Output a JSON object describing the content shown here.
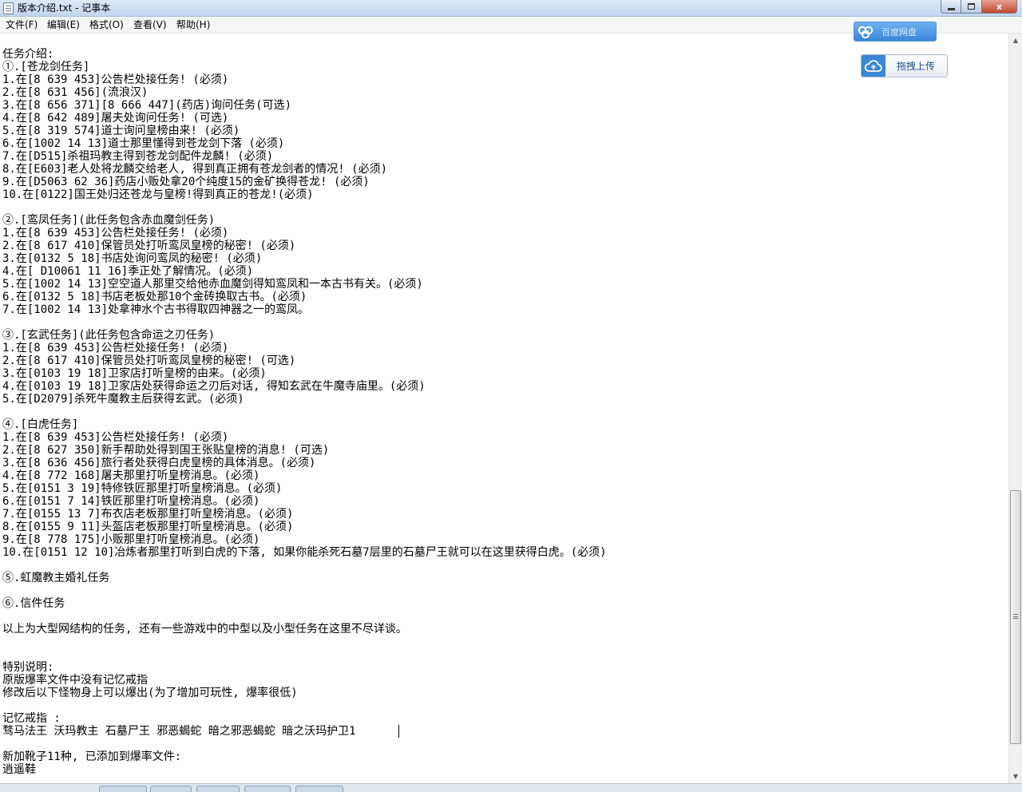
{
  "window": {
    "title": "版本介绍.txt - 记事本",
    "min_label": "",
    "max_label": "",
    "close_label": "x"
  },
  "menu": {
    "file": "文件(F)",
    "edit": "编辑(E)",
    "format": "格式(O)",
    "view": "查看(V)",
    "help": "帮助(H)"
  },
  "floating": {
    "top_label": "百度网盘",
    "upload_label": "拖拽上传"
  },
  "scrollbar": {
    "up_arrow": "▲",
    "down_arrow": "▼",
    "position_fraction": 0.78
  },
  "document": {
    "lines": [
      "任务介绍:",
      "①.[苍龙剑任务]",
      "1.在[8 639 453]公告栏处接任务! (必须)",
      "2.在[8 631 456](流浪汉)",
      "3.在[8 656 371][8 666 447](药店)询问任务(可选)",
      "4.在[8 642 489]屠夫处询问任务! (可选)",
      "5.在[8 319 574]道士询问皇榜由来! (必须)",
      "6.在[1002 14 13]道士那里懂得到苍龙剑下落 (必须)",
      "7.在[D515]杀祖玛教主得到苍龙剑配件龙麟! (必须)",
      "8.在[E603]老人处将龙麟交给老人, 得到真正拥有苍龙剑者的情况! (必须)",
      "9.在[D5063 62 36]药店小贩处拿20个纯度15的金矿换得苍龙! (必须)",
      "10.在[0122]国王处归还苍龙与皇榜!得到真正的苍龙!(必须)",
      "",
      "②.[鸾凤任务](此任务包含赤血魔剑任务)",
      "1.在[8 639 453]公告栏处接任务! (必须)",
      "2.在[8 617 410]保管员处打听鸾凤皇榜的秘密! (必须)",
      "3.在[0132 5 18]书店处询问鸾凤的秘密! (必须)",
      "4.在[ D10061 11 16]季正处了解情况。(必须)",
      "5.在[1002 14 13]空空道人那里交给他赤血魔剑得知鸾凤和一本古书有关。(必须)",
      "6.在[0132 5 18]书店老板处那10个金砖换取古书。(必须)",
      "7.在[1002 14 13]处拿神水个古书得取四神器之一的鸾凤。",
      "",
      "③.[玄武任务](此任务包含命运之刃任务)",
      "1.在[8 639 453]公告栏处接任务! (必须)",
      "2.在[8 617 410]保管员处打听鸾凤皇榜的秘密! (可选)",
      "3.在[0103 19 18]卫家店打听皇榜的由来。(必须)",
      "4.在[0103 19 18]卫家店处获得命运之刃后对话, 得知玄武在牛魔寺庙里。(必须)",
      "5.在[D2079]杀死牛魔教主后获得玄武。(必须)",
      "",
      "④.[白虎任务]",
      "1.在[8 639 453]公告栏处接任务! (必须)",
      "2.在[8 627 350]新手帮助处得到国王张贴皇榜的消息! (可选)",
      "3.在[8 636 456]旅行者处获得白虎皇榜的具体消息。(必须)",
      "4.在[8 772 168]屠夫那里打听皇榜消息。(必须)",
      "5.在[0151 3 19]特修铁匠那里打听皇榜消息。(必须)",
      "6.在[0151 7 14]铁匠那里打听皇榜消息。(必须)",
      "7.在[0155 13 7]布衣店老板那里打听皇榜消息。(必须)",
      "8.在[0155 9 11]头盔店老板那里打听皇榜消息。(必须)",
      "9.在[8 778 175]小贩那里打听皇榜消息。(必须)",
      "10.在[0151 12 10]冶炼者那里打听到白虎的下落, 如果你能杀死石墓7层里的石墓尸王就可以在这里获得白虎。(必须)",
      "",
      "⑤.虹魔教主婚礼任务",
      "",
      "⑥.信件任务",
      "",
      "以上为大型网结构的任务, 还有一些游戏中的中型以及小型任务在这里不尽详谈。",
      "",
      "",
      "特别说明:",
      "原版爆率文件中没有记忆戒指",
      "修改后以下怪物身上可以爆出(为了增加可玩性, 爆率很低)",
      "",
      "记忆戒指 :",
      "骛马法王 沃玛教主 石墓尸王 邪恶蝎蛇 暗之邪恶蝎蛇 暗之沃玛护卫1",
      "",
      "新加靴子11种, 已添加到爆率文件:",
      "逍遥鞋"
    ]
  }
}
